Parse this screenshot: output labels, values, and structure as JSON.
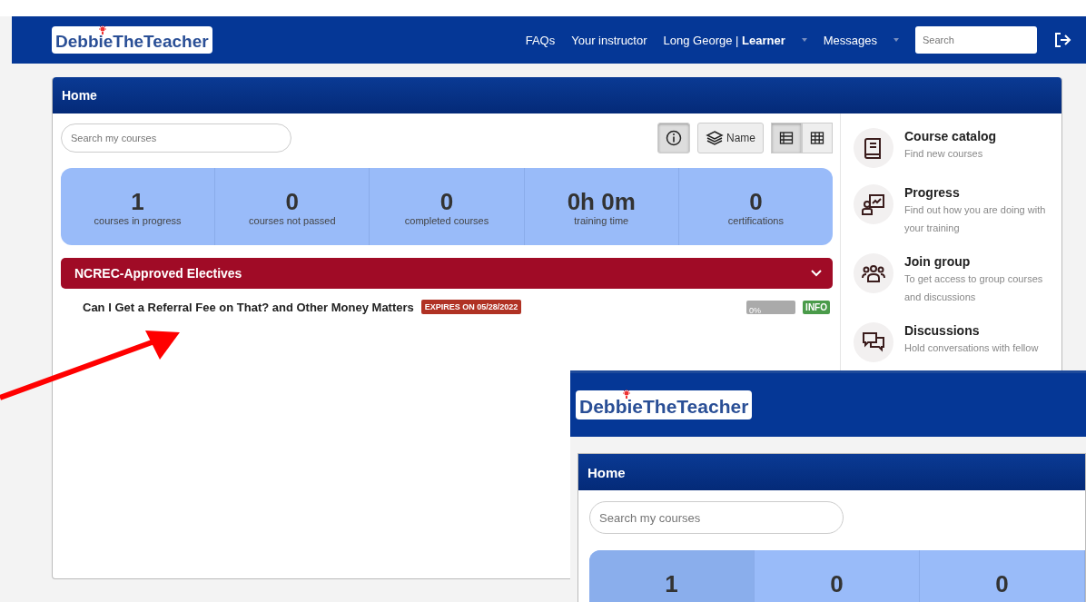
{
  "navbar": {
    "logo": "DebbieTheTeacher",
    "links": [
      "FAQs",
      "Your instructor"
    ],
    "user": {
      "name": "Long George",
      "separator": "|",
      "role": "Learner"
    },
    "messages": "Messages",
    "search": {
      "placeholder": "Search"
    }
  },
  "home": {
    "title": "Home",
    "search": {
      "placeholder": "Search my courses"
    },
    "sort_label": "Name",
    "views": [
      {
        "kind": "list",
        "selected": true
      },
      {
        "kind": "grid",
        "selected": false
      }
    ],
    "stats": [
      {
        "value": "1",
        "label": "courses in progress"
      },
      {
        "value": "0",
        "label": "courses not passed"
      },
      {
        "value": "0",
        "label": "completed courses"
      },
      {
        "value": "0h 0m",
        "label": "training time"
      },
      {
        "value": "0",
        "label": "certifications"
      }
    ],
    "category": {
      "title": "NCREC-Approved Electives",
      "expanded": true,
      "courses": [
        {
          "title": "Can I Get a Referral Fee on That? and Other Money Matters",
          "badge": "EXPIRES ON 05/28/2022",
          "progress": "0%",
          "level": 0,
          "info": "INFO"
        }
      ]
    },
    "sidebar": [
      {
        "kind": "catalog",
        "title": "Course catalog",
        "subtitle": "Find new courses"
      },
      {
        "kind": "progress",
        "title": "Progress",
        "subtitle": "Find out how you are doing with your training"
      },
      {
        "kind": "group",
        "title": "Join group",
        "subtitle": "To get access to group courses and discussions"
      },
      {
        "kind": "discussions",
        "title": "Discussions",
        "subtitle": "Hold conversations with fellow"
      }
    ]
  },
  "inset": {
    "logo": "DebbieTheTeacher",
    "title": "Home",
    "search": {
      "placeholder": "Search my courses"
    },
    "stats": [
      {
        "value": "1",
        "highlighted": true
      },
      {
        "value": "0",
        "highlighted": false
      },
      {
        "value": "0",
        "highlighted": false
      }
    ]
  }
}
